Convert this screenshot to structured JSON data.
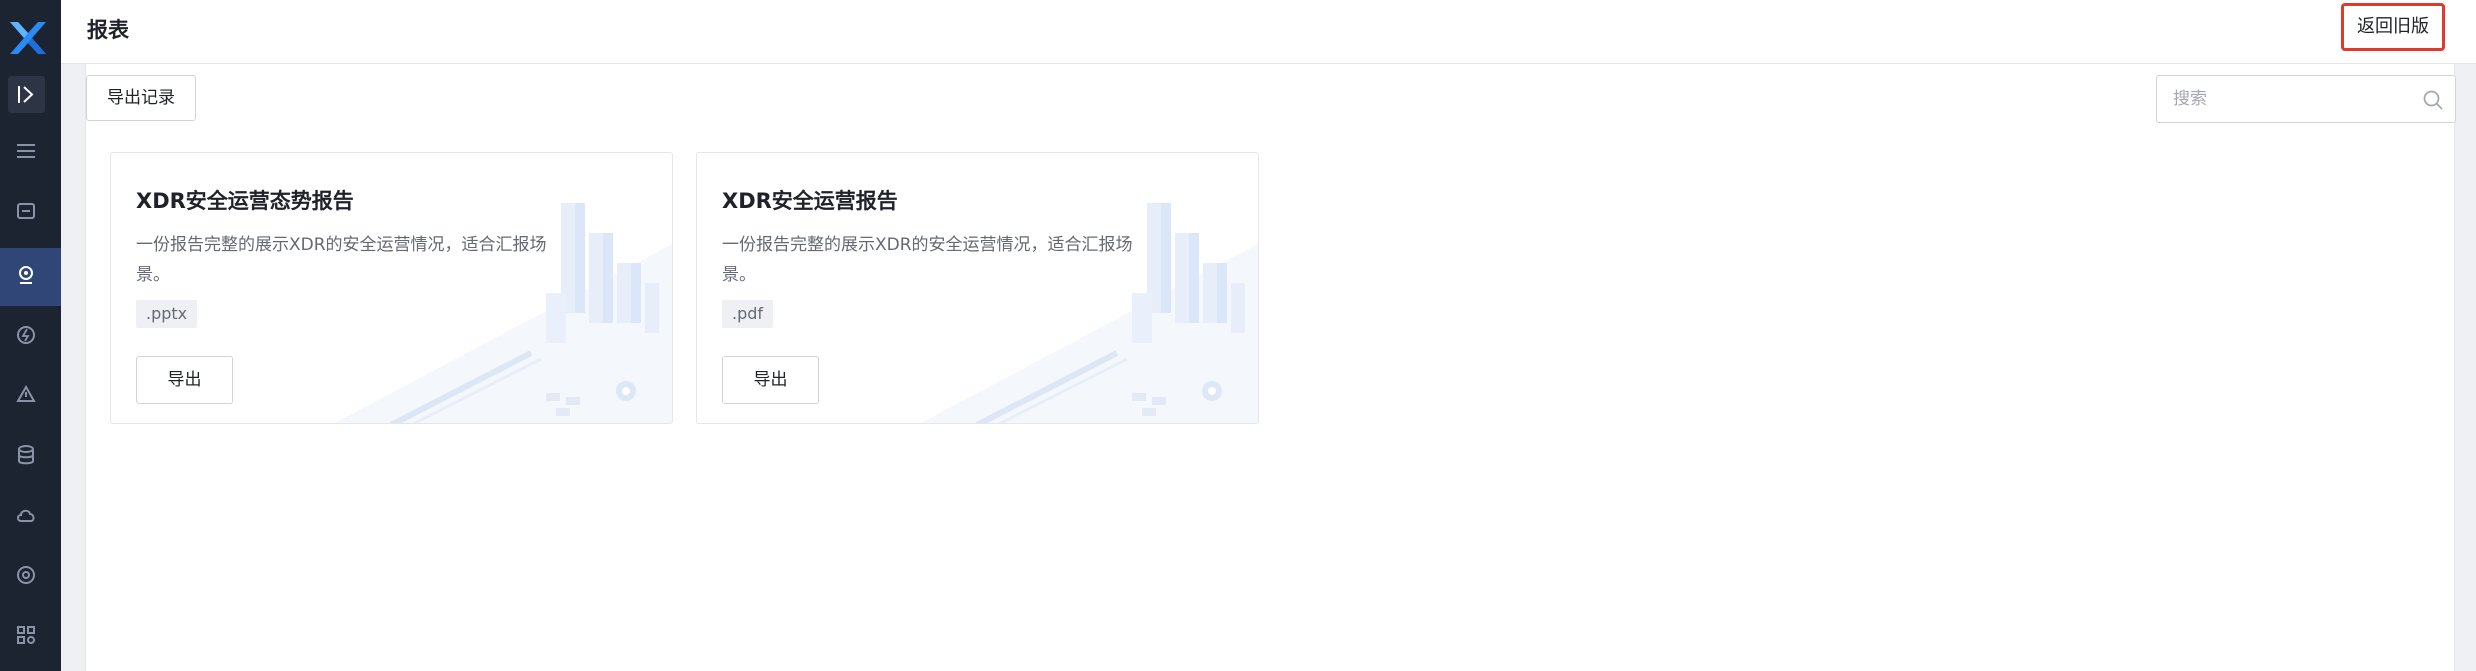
{
  "header": {
    "title": "报表",
    "old_version_label": "返回旧版"
  },
  "sidebar": {
    "items": [
      {
        "icon": "menu-icon"
      },
      {
        "icon": "inbox-icon"
      },
      {
        "icon": "location-icon",
        "active": true
      },
      {
        "icon": "lightning-icon"
      },
      {
        "icon": "alert-icon"
      },
      {
        "icon": "database-icon"
      },
      {
        "icon": "cloud-icon"
      },
      {
        "icon": "target-icon"
      },
      {
        "icon": "grid-settings-icon"
      }
    ]
  },
  "toolbar": {
    "export_log_label": "导出记录",
    "search_placeholder": "搜索"
  },
  "cards": [
    {
      "title": "XDR安全运营态势报告",
      "description": "一份报告完整的展示XDR的安全运营情况，适合汇报场景。",
      "format": ".pptx",
      "button_label": "导出"
    },
    {
      "title": "XDR安全运营报告",
      "description": "一份报告完整的展示XDR的安全运营情况，适合汇报场景。",
      "format": ".pdf",
      "button_label": "导出"
    }
  ],
  "colors": {
    "sidebar_bg": "#1c2331",
    "active_nav": "#2f4677",
    "highlight_border": "#e0392e"
  }
}
